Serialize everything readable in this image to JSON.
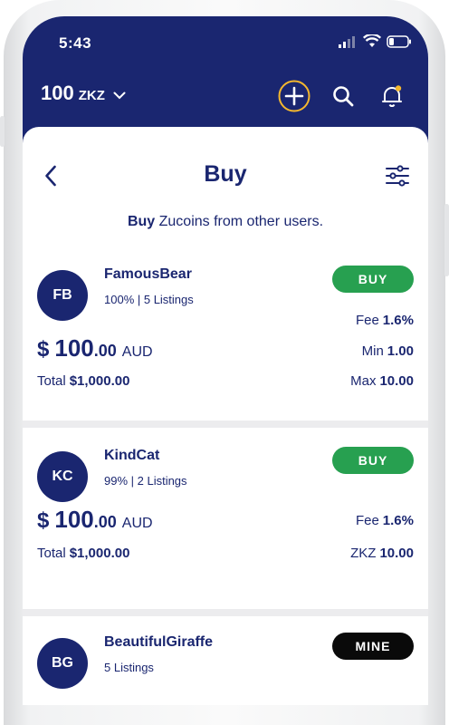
{
  "status": {
    "time": "5:43"
  },
  "header": {
    "balance_amount": "100",
    "balance_currency": "ZKZ"
  },
  "page": {
    "title": "Buy",
    "subtitle_bold": "Buy",
    "subtitle_rest": " Zucoins from other users."
  },
  "listings": [
    {
      "initials": "FB",
      "name": "FamousBear",
      "meta": "100%  |  5 Listings",
      "button": "BUY",
      "fee_label": "Fee",
      "fee": "1.6%",
      "price_symbol": "$",
      "price_int": "100",
      "price_dec": ".00",
      "price_currency": "AUD",
      "min_label": "Min",
      "min": "1.00",
      "total_label": "Total",
      "total": "$1,000.00",
      "max_label": "Max",
      "max": "10.00"
    },
    {
      "initials": "KC",
      "name": "KindCat",
      "meta": "99%  |  2 Listings",
      "button": "BUY",
      "fee_label": "Fee",
      "fee": "1.6%",
      "price_symbol": "$",
      "price_int": "100",
      "price_dec": ".00",
      "price_currency": "AUD",
      "total_label": "Total",
      "total": "$1,000.00",
      "amount_label": "ZKZ",
      "amount": "10.00"
    },
    {
      "initials": "BG",
      "name": "BeautifulGiraffe",
      "meta": "5 Listings",
      "button": "MINE"
    }
  ],
  "colors": {
    "navy": "#1a2670",
    "buy_green": "#27a050",
    "mine_black": "#0a0a0a",
    "accent_yellow": "#f5b82e"
  }
}
